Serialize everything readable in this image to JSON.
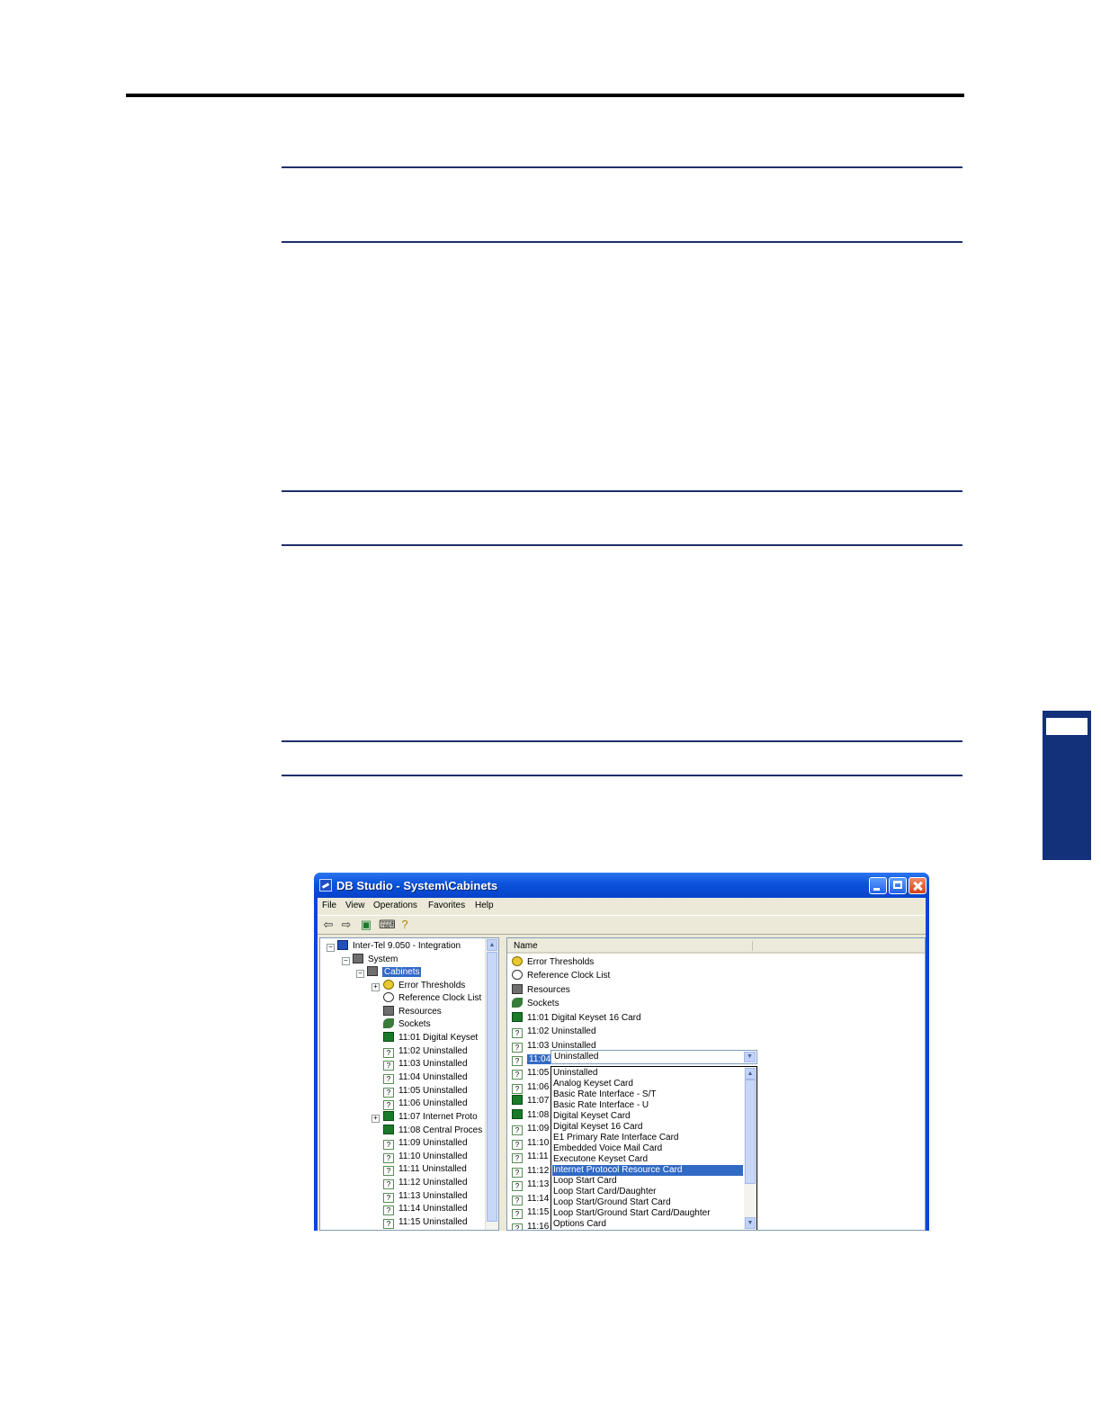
{
  "window": {
    "title": "DB Studio - System\\Cabinets",
    "menu": [
      "File",
      "View",
      "Operations",
      "Favorites",
      "Help"
    ],
    "toolbar_icons": [
      "back-arrow-icon",
      "forward-arrow-icon",
      "refresh-icon",
      "print-icon",
      "help-icon"
    ]
  },
  "tree": {
    "root": "Inter-Tel 9.050 - Integration",
    "system": "System",
    "cabinets": "Cabinets",
    "items": [
      "Error Thresholds",
      "Reference Clock List",
      "Resources",
      "Sockets",
      "11:01 Digital Keyset",
      "11:02 Uninstalled",
      "11:03 Uninstalled",
      "11:04 Uninstalled",
      "11:05 Uninstalled",
      "11:06 Uninstalled",
      "11:07 Internet Proto",
      "11:08 Central Proces",
      "11:09 Uninstalled",
      "11:10 Uninstalled",
      "11:11 Uninstalled",
      "11:12 Uninstalled",
      "11:13 Uninstalled",
      "11:14 Uninstalled",
      "11:15 Uninstalled"
    ]
  },
  "list": {
    "column": "Name",
    "items": [
      "Error Thresholds",
      "Reference Clock List",
      "Resources",
      "Sockets",
      "11:01 Digital Keyset 16 Card",
      "11:02 Uninstalled",
      "11:03 Uninstalled"
    ],
    "selected_cell": "11:04",
    "partial_rows": [
      "11:05",
      "11:06",
      "11:07",
      "11:08",
      "11:09",
      "11:10",
      "11:11",
      "11:12",
      "11:13",
      "11:14",
      "11:15",
      "11:16"
    ]
  },
  "dropdown": {
    "value": "Uninstalled",
    "options": [
      "Uninstalled",
      "Analog Keyset Card",
      "Basic Rate Interface - S/T",
      "Basic Rate Interface - U",
      "Digital Keyset Card",
      "Digital Keyset 16 Card",
      "E1 Primary Rate Interface Card",
      "Embedded Voice Mail Card",
      "Executone Keyset Card",
      "Internet Protocol Resource Card",
      "Loop Start Card",
      "Loop Start Card/Daughter",
      "Loop Start/Ground Start Card",
      "Loop Start/Ground Start Card/Daughter",
      "Options Card"
    ],
    "highlighted": "Internet Protocol Resource Card"
  }
}
